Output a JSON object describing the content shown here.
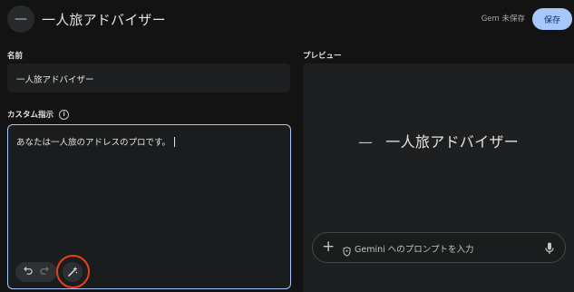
{
  "header": {
    "avatar_glyph": "—",
    "title": "一人旅アドバイザー",
    "unsaved_status": "Gem 未保存",
    "save_label": "保存"
  },
  "form": {
    "name_label": "名前",
    "name_value": "一人旅アドバイザー",
    "instructions_label": "カスタム指示",
    "instructions_value": "あなたは一人旅のアドレスのプロです。"
  },
  "preview": {
    "label": "プレビュー",
    "title_glyph": "—",
    "title": "一人旅アドバイザー",
    "prompt_placeholder": "Gemini へのプロンプトを入力"
  },
  "icons": {
    "info": "info-icon",
    "undo": "undo-icon",
    "redo": "redo-icon",
    "magic": "magic-wand-icon",
    "plus": "plus-icon",
    "shield": "shield-icon",
    "mic": "mic-icon"
  },
  "colors": {
    "accent": "#a8c7fa",
    "highlight": "#e8401b",
    "background": "#131314"
  }
}
